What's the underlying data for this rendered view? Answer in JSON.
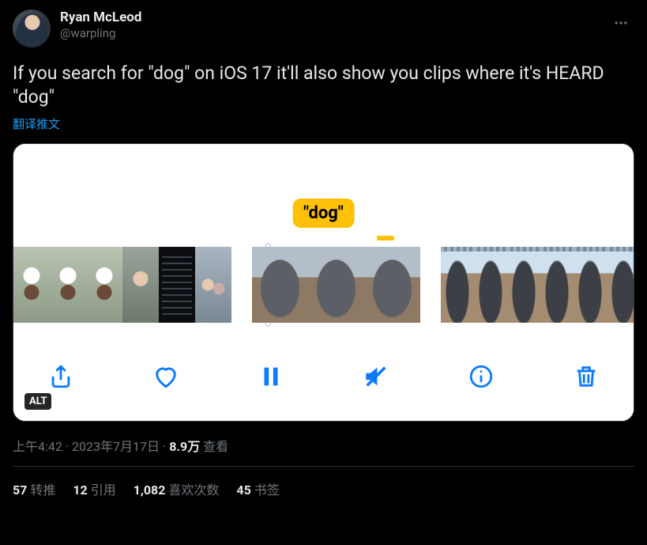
{
  "author": {
    "display_name": "Ryan McLeod",
    "handle": "@warpling"
  },
  "tweet_text": "If you search for \"dog\" on iOS 17 it'll also show you clips where it's HEARD \"dog\"",
  "translate_label": "翻译推文",
  "media": {
    "tag_label": "\"dog\"",
    "alt_badge": "ALT",
    "toolbar_icons": [
      "share",
      "heart",
      "pause",
      "mute",
      "info",
      "trash"
    ]
  },
  "meta": {
    "time": "上午4:42",
    "date": "2023年7月17日",
    "views_count": "8.9万",
    "views_label": "查看"
  },
  "stats": {
    "retweets": {
      "count": "57",
      "label": "转推"
    },
    "quotes": {
      "count": "12",
      "label": "引用"
    },
    "likes": {
      "count": "1,082",
      "label": "喜欢次数"
    },
    "bookmarks": {
      "count": "45",
      "label": "书签"
    }
  }
}
